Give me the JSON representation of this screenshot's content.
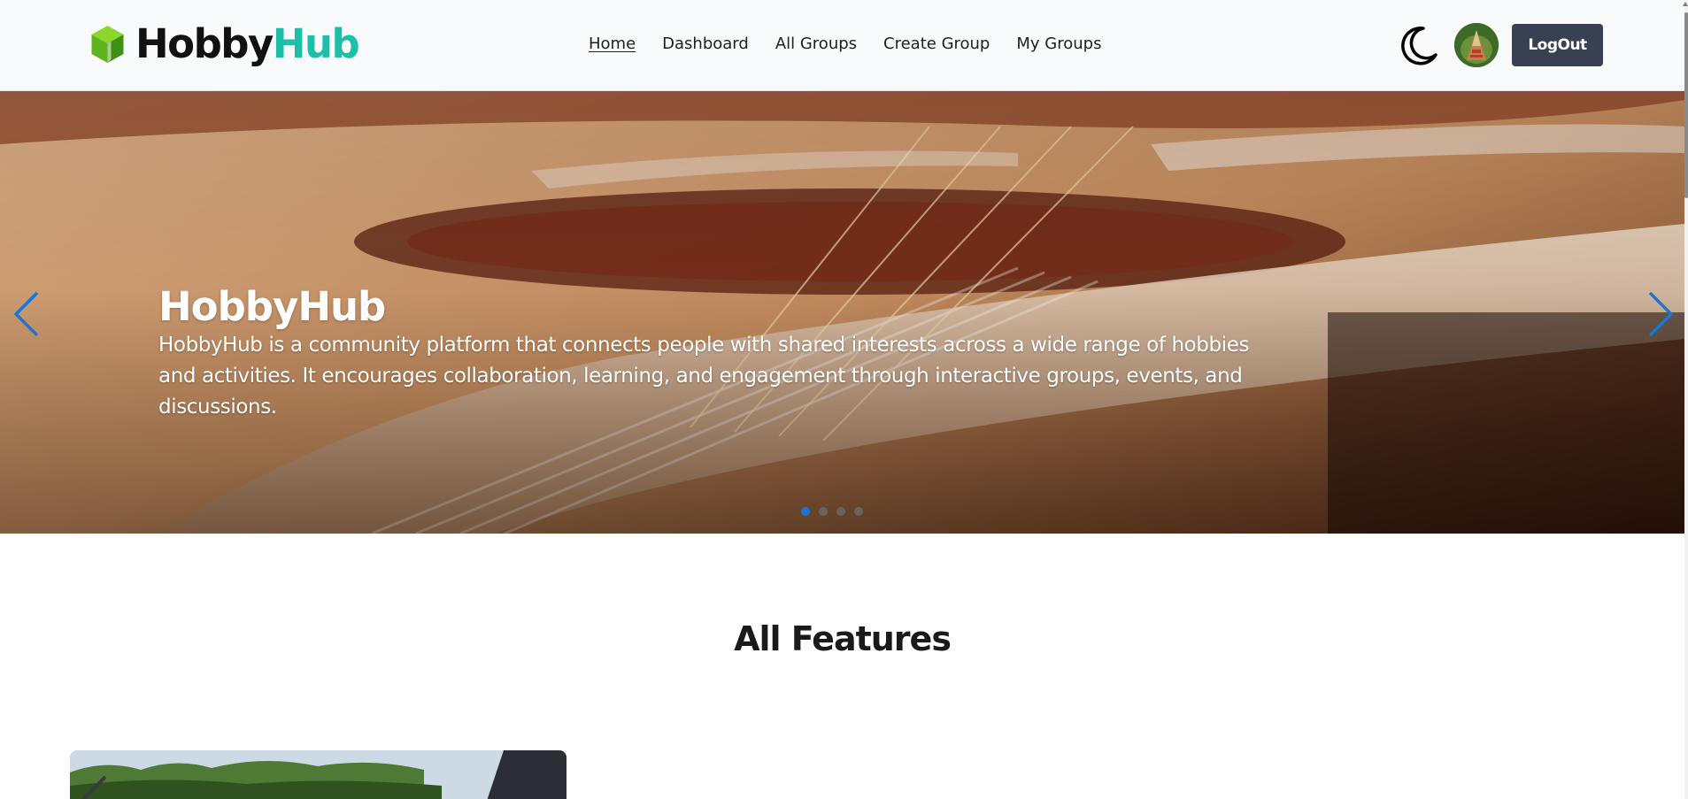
{
  "brand": {
    "name_part1": "Hobby",
    "name_part2": "Hub",
    "accent_color": "#1dbfa9",
    "logo_icon": "green-cube-icon"
  },
  "nav": {
    "links": [
      {
        "label": "Home",
        "active": true
      },
      {
        "label": "Dashboard",
        "active": false
      },
      {
        "label": "All Groups",
        "active": false
      },
      {
        "label": "Create Group",
        "active": false
      },
      {
        "label": "My Groups",
        "active": false
      }
    ],
    "theme_toggle_icon": "moon-icon",
    "logout_label": "LogOut",
    "logout_color": "#374151"
  },
  "hero": {
    "title": "HobbyHub",
    "description": "HobbyHub is a community platform that connects people with shared interests across a wide range of hobbies and activities. It encourages collaboration, learning, and engagement through interactive groups, events, and discussions.",
    "background_image": "guitar-strings-closeup",
    "slide_count": 4,
    "active_slide": 1,
    "arrow_color": "#1976d2"
  },
  "features": {
    "title": "All Features"
  }
}
